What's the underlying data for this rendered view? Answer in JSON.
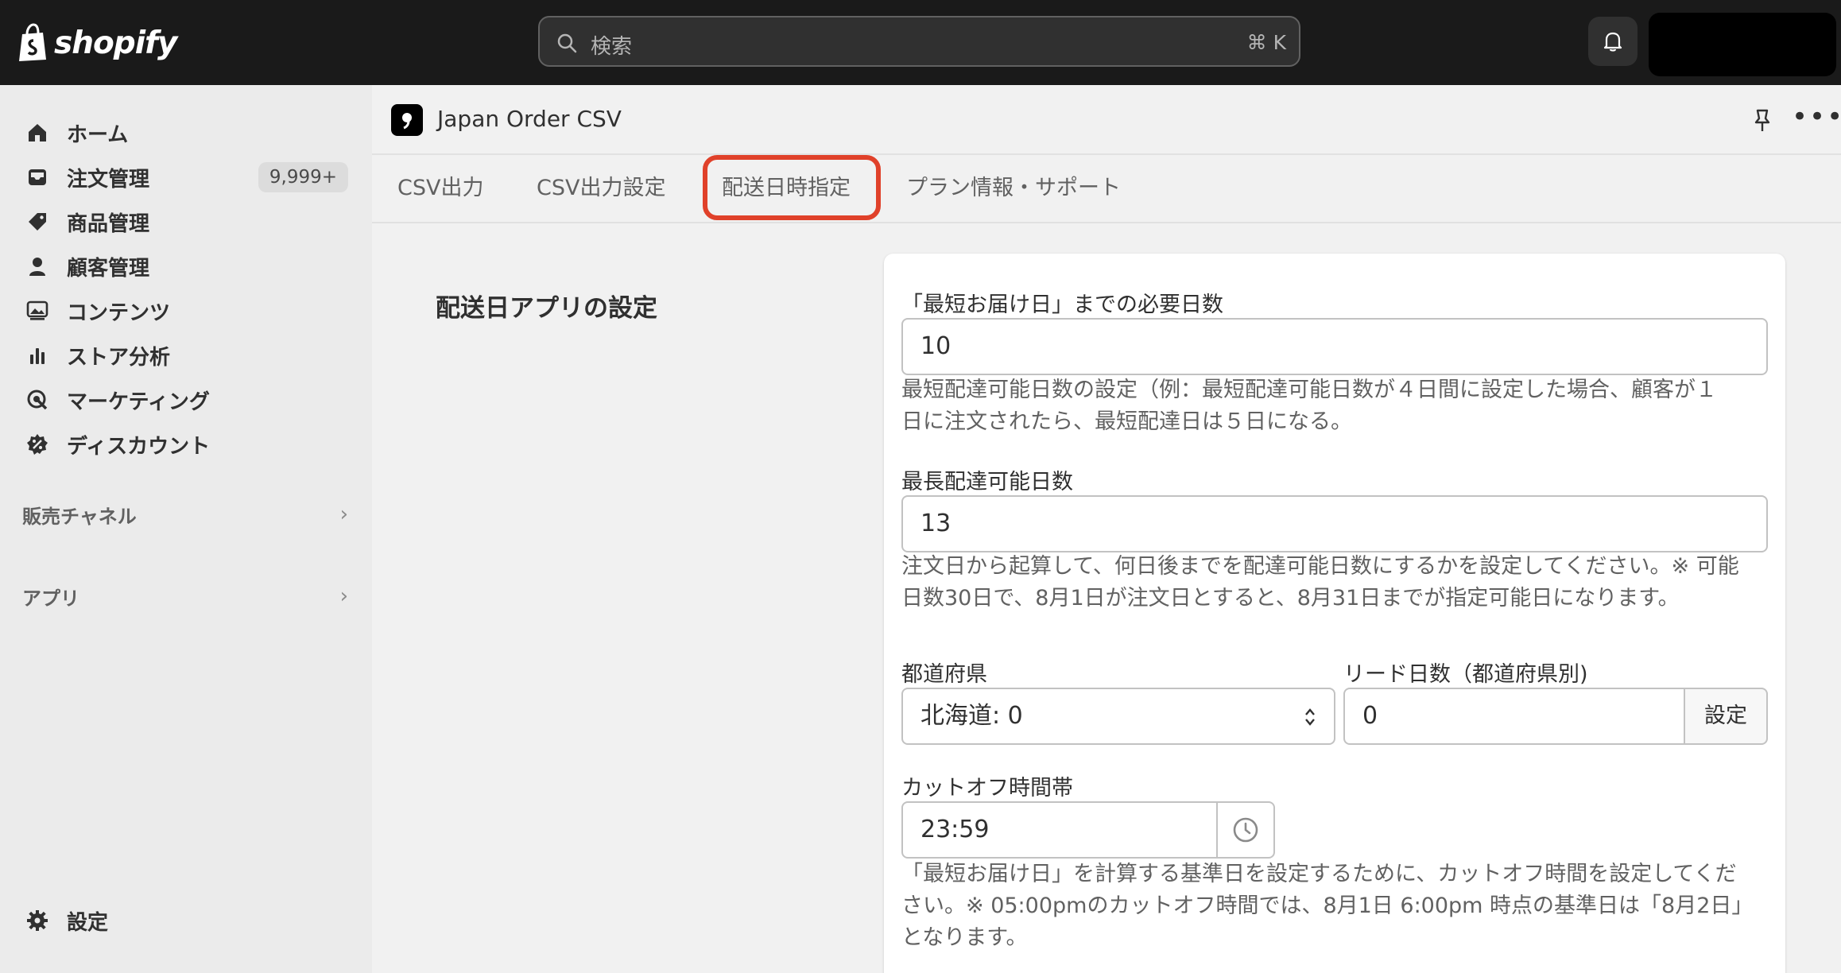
{
  "brand": {
    "name": "shopify"
  },
  "search": {
    "placeholder": "検索",
    "shortcut": "⌘ K"
  },
  "sidebar": {
    "items": [
      {
        "label": "ホーム",
        "icon": "home-icon"
      },
      {
        "label": "注文管理",
        "icon": "inbox-icon",
        "badge": "9,999+"
      },
      {
        "label": "商品管理",
        "icon": "tag-icon"
      },
      {
        "label": "顧客管理",
        "icon": "person-icon"
      },
      {
        "label": "コンテンツ",
        "icon": "image-icon"
      },
      {
        "label": "ストア分析",
        "icon": "bar-chart-icon"
      },
      {
        "label": "マーケティング",
        "icon": "target-icon"
      },
      {
        "label": "ディスカウント",
        "icon": "discount-icon"
      }
    ],
    "sections": [
      {
        "label": "販売チャネル"
      },
      {
        "label": "アプリ"
      }
    ],
    "settings_label": "設定"
  },
  "app": {
    "title": "Japan Order CSV"
  },
  "tabs": [
    {
      "label": "CSV出力"
    },
    {
      "label": "CSV出力設定"
    },
    {
      "label": "配送日時指定",
      "active": true
    },
    {
      "label": "プラン情報・サポート"
    }
  ],
  "main": {
    "section_title": "配送日アプリの設定",
    "min_days": {
      "label": "「最短お届け日」までの必要日数",
      "value": "10",
      "help_line1": "最短配達可能日数の設定（例：最短配達可能日数が４日間に設定した場合、顧客が１",
      "help_line2": "日に注文されたら、最短配達日は５日になる。"
    },
    "max_days": {
      "label": "最長配達可能日数",
      "value": "13",
      "help_line1": "注文日から起算して、何日後までを配達可能日数にするかを設定してください。※ 可能",
      "help_line2": "日数30日で、8月1日が注文日とすると、8月31日までが指定可能日になります。"
    },
    "prefecture": {
      "label": "都道府県",
      "value": "北海道: 0"
    },
    "lead_days": {
      "label": "リード日数（都道府県別)",
      "value": "0",
      "button": "設定"
    },
    "cutoff": {
      "label": "カットオフ時間帯",
      "value": "23:59",
      "help_line1": "「最短お届け日」を計算する基準日を設定するために、カットオフ時間を設定してくだ",
      "help_line2": "さい。※ 05:00pmのカットオフ時間では、8月1日 6:00pm 時点の基準日は「8月2日」",
      "help_line3": "となります。"
    }
  },
  "colors": {
    "topbar": "#1a1a1a",
    "highlight": "#e0412a",
    "sidebar": "#ebebeb"
  }
}
